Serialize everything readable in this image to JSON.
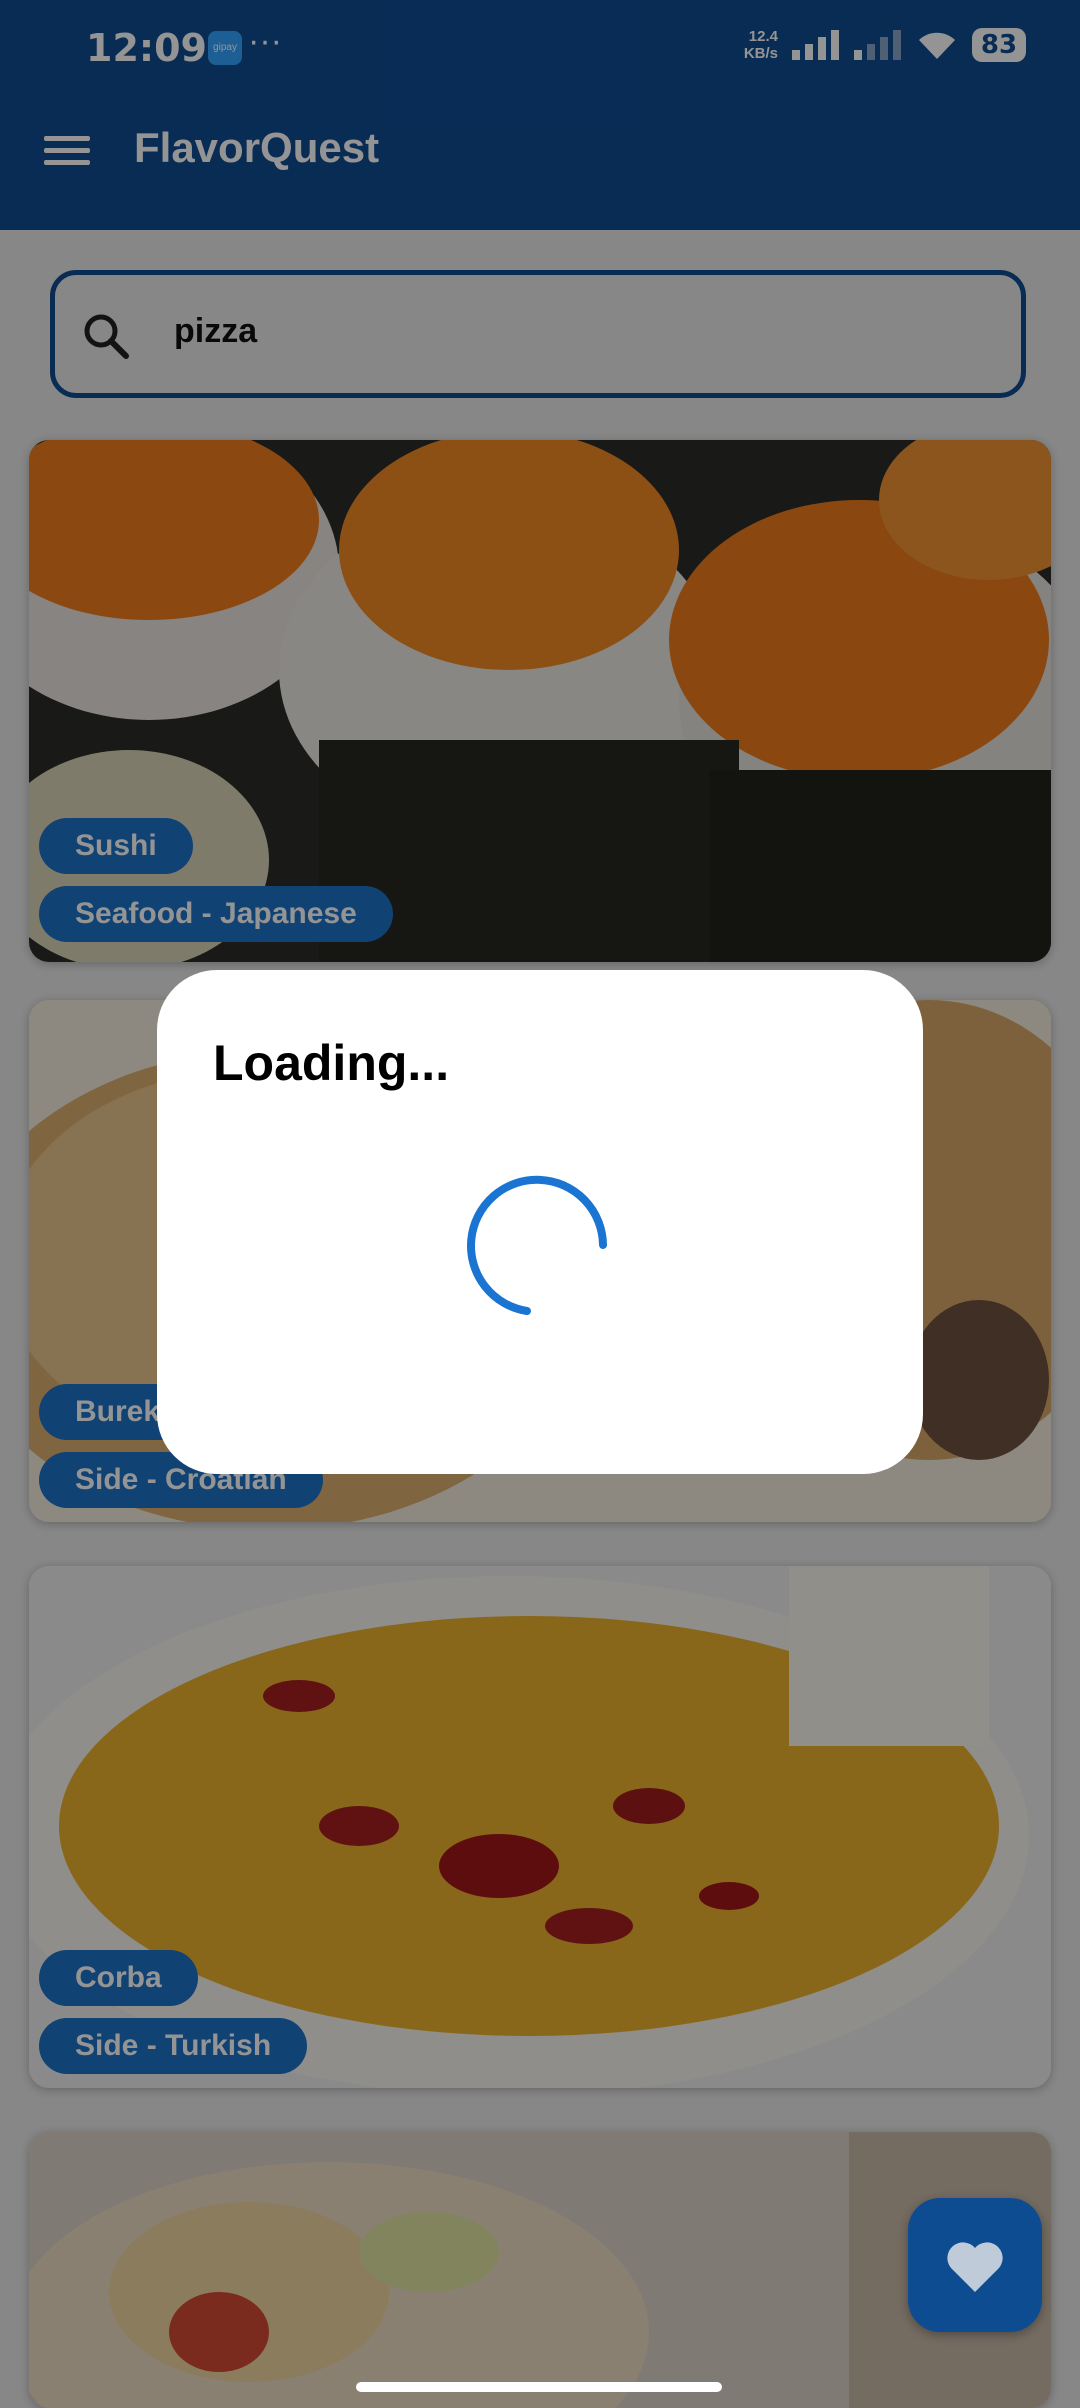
{
  "status_bar": {
    "time": "12:09",
    "app_badge": "gipay",
    "overflow": "···",
    "net_speed_value": "12.4",
    "net_speed_unit": "KB/s",
    "battery": "83"
  },
  "app_bar": {
    "title": "FlavorQuest",
    "menu_icon": "hamburger-menu-icon"
  },
  "search": {
    "value": "pizza",
    "icon": "search-icon"
  },
  "meals": [
    {
      "name": "Sushi",
      "tag": "Seafood - Japanese"
    },
    {
      "name": "Burek",
      "tag": "Side - Croatian"
    },
    {
      "name": "Corba",
      "tag": "Side - Turkish"
    },
    {
      "name": "",
      "tag": ""
    }
  ],
  "dialog": {
    "title": "Loading...",
    "spinner_icon": "loading-spinner-icon"
  },
  "fab": {
    "icon": "heart-icon"
  },
  "colors": {
    "primary": "#0e4c92",
    "chip": "#1e73c8",
    "spinner": "#1a74d2"
  }
}
